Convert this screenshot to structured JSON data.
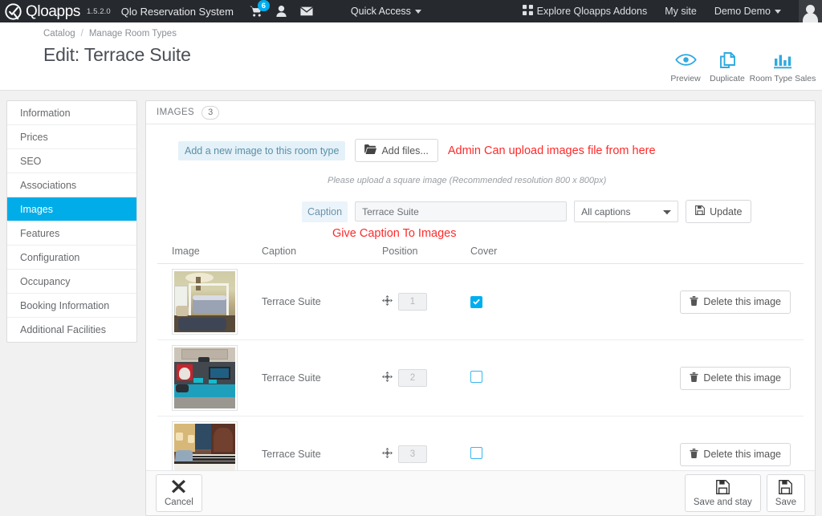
{
  "topnav": {
    "brand": "Qloapps",
    "version": "1.5.2.0",
    "shop_name": "Qlo Reservation System",
    "cart_badge": "6",
    "cart_icon": "shopping-cart-icon",
    "customer_icon": "customer-icon",
    "mail_icon": "envelope-icon",
    "quick_access": "Quick Access",
    "explore_addons": "Explore Qloapps Addons",
    "my_site": "My site",
    "employee": "Demo Demo",
    "avatar": "employee-avatar"
  },
  "header": {
    "breadcrumb": [
      "Catalog",
      "Manage Room Types"
    ],
    "breadcrumb_sep": "/",
    "title": "Edit: Terrace Suite",
    "tools": [
      {
        "label": "Preview",
        "icon": "eye-icon"
      },
      {
        "label": "Duplicate",
        "icon": "duplicate-icon"
      },
      {
        "label": "Room Type Sales",
        "icon": "bar-chart-icon"
      }
    ]
  },
  "sidebar": {
    "items": [
      {
        "label": "Information",
        "active": false
      },
      {
        "label": "Prices",
        "active": false
      },
      {
        "label": "SEO",
        "active": false
      },
      {
        "label": "Associations",
        "active": false
      },
      {
        "label": "Images",
        "active": true
      },
      {
        "label": "Features",
        "active": false
      },
      {
        "label": "Configuration",
        "active": false
      },
      {
        "label": "Occupancy",
        "active": false
      },
      {
        "label": "Booking Information",
        "active": false
      },
      {
        "label": "Additional Facilities",
        "active": false
      }
    ]
  },
  "panel": {
    "title": "IMAGES",
    "count": "3",
    "upload": {
      "label": "Add a new image to this room type",
      "add_files_button": "Add files...",
      "add_files_icon": "folder-open-icon",
      "annotation": "Admin Can upload images file from here",
      "hint": "Please upload a square image (Recommended resolution 800 x 800px)"
    },
    "caption": {
      "label": "Caption",
      "value": "Terrace Suite",
      "placeholder": "",
      "select_value": "All captions",
      "select_options": [
        "All captions"
      ],
      "update_button": "Update",
      "update_icon": "save-icon",
      "annotation": "Give Caption To Images"
    },
    "table": {
      "headers": [
        "Image",
        "Caption",
        "Position",
        "Cover"
      ],
      "rows": [
        {
          "caption": "Terrace Suite",
          "position": "1",
          "cover": true,
          "delete_label": "Delete this image",
          "delete_icon": "trash-icon",
          "move_icon": "move-handle-icon",
          "thumb_alt": "terrace-suite-bedroom-canopy-bed"
        },
        {
          "caption": "Terrace Suite",
          "position": "2",
          "cover": false,
          "delete_label": "Delete this image",
          "delete_icon": "trash-icon",
          "move_icon": "move-handle-icon",
          "thumb_alt": "terrace-suite-lounge-blue-rug"
        },
        {
          "caption": "Terrace Suite",
          "position": "3",
          "cover": false,
          "delete_label": "Delete this image",
          "delete_icon": "trash-icon",
          "move_icon": "move-handle-icon",
          "thumb_alt": "terrace-suite-striped-bed"
        }
      ]
    },
    "footer": {
      "cancel": "Cancel",
      "cancel_icon": "close-x-icon",
      "save_and_stay": "Save and stay",
      "save_and_stay_icon": "floppy-icon",
      "save": "Save",
      "save_icon": "floppy-icon"
    }
  },
  "colors": {
    "accent": "#00aeef",
    "topnav_bg": "#26292e",
    "annotation_red": "#ff2a2a",
    "page_bg": "#f1f1f1"
  }
}
